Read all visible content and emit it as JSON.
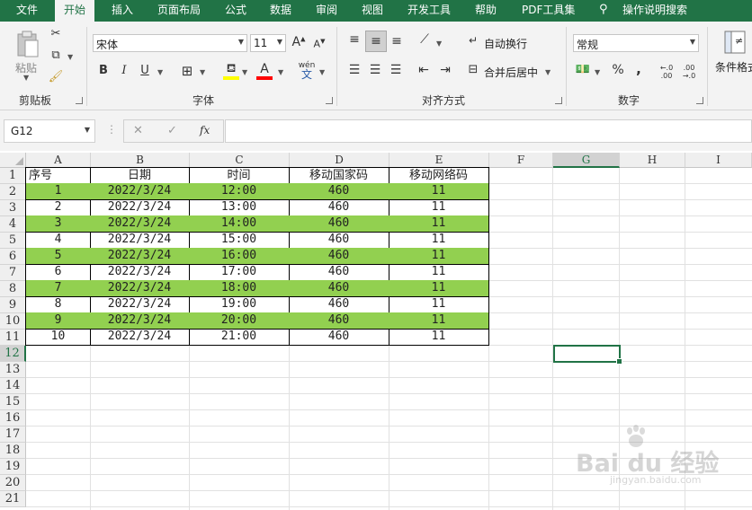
{
  "ribbon_tabs": [
    "文件",
    "开始",
    "插入",
    "页面布局",
    "公式",
    "数据",
    "审阅",
    "视图",
    "开发工具",
    "帮助",
    "PDF工具集",
    "操作说明搜索"
  ],
  "active_tab": "开始",
  "clipboard": {
    "paste_label": "粘贴",
    "group_label": "剪贴板"
  },
  "font": {
    "name": "宋体",
    "size": "11",
    "group_label": "字体",
    "increase_label": "A",
    "decrease_label": "A",
    "bold_label": "B",
    "italic_label": "I",
    "underline_label": "U",
    "font_color_label": "A",
    "phonetic_label": "wén"
  },
  "alignment": {
    "wrap_label": "自动换行",
    "merge_label": "合并后居中",
    "group_label": "对齐方式"
  },
  "number": {
    "format": "常规",
    "group_label": "数字",
    "percent_label": "%",
    "comma_label": ",",
    "inc_decimal_label": "←.0\n.00",
    "dec_decimal_label": ".00\n→.0"
  },
  "styles": {
    "conditional_label": "条件格式"
  },
  "formula_bar": {
    "name_box": "G12",
    "cancel_label": "✕",
    "enter_label": "✓",
    "fx_label": "fx",
    "formula": ""
  },
  "columns": [
    "A",
    "B",
    "C",
    "D",
    "E",
    "F",
    "G",
    "H",
    "I"
  ],
  "selected_column": "G",
  "selected_row": "12",
  "row_numbers": [
    "1",
    "2",
    "3",
    "4",
    "5",
    "6",
    "7",
    "8",
    "9",
    "10",
    "11",
    "12",
    "13",
    "14",
    "15",
    "16",
    "17",
    "18",
    "19",
    "20",
    "21"
  ],
  "table": {
    "headers": [
      "序号",
      "日期",
      "时间",
      "移动国家码",
      "移动网络码"
    ],
    "rows": [
      [
        "1",
        "2022/3/24",
        "12:00",
        "460",
        "11"
      ],
      [
        "2",
        "2022/3/24",
        "13:00",
        "460",
        "11"
      ],
      [
        "3",
        "2022/3/24",
        "14:00",
        "460",
        "11"
      ],
      [
        "4",
        "2022/3/24",
        "15:00",
        "460",
        "11"
      ],
      [
        "5",
        "2022/3/24",
        "16:00",
        "460",
        "11"
      ],
      [
        "6",
        "2022/3/24",
        "17:00",
        "460",
        "11"
      ],
      [
        "7",
        "2022/3/24",
        "18:00",
        "460",
        "11"
      ],
      [
        "8",
        "2022/3/24",
        "19:00",
        "460",
        "11"
      ],
      [
        "9",
        "2022/3/24",
        "20:00",
        "460",
        "11"
      ],
      [
        "10",
        "2022/3/24",
        "21:00",
        "460",
        "11"
      ]
    ],
    "highlight_color": "#92d050"
  },
  "watermark": {
    "brand": "Bai du 经验",
    "url": "jingyan.baidu.com"
  },
  "colors": {
    "accent": "#217346",
    "highlight": "#92d050"
  }
}
